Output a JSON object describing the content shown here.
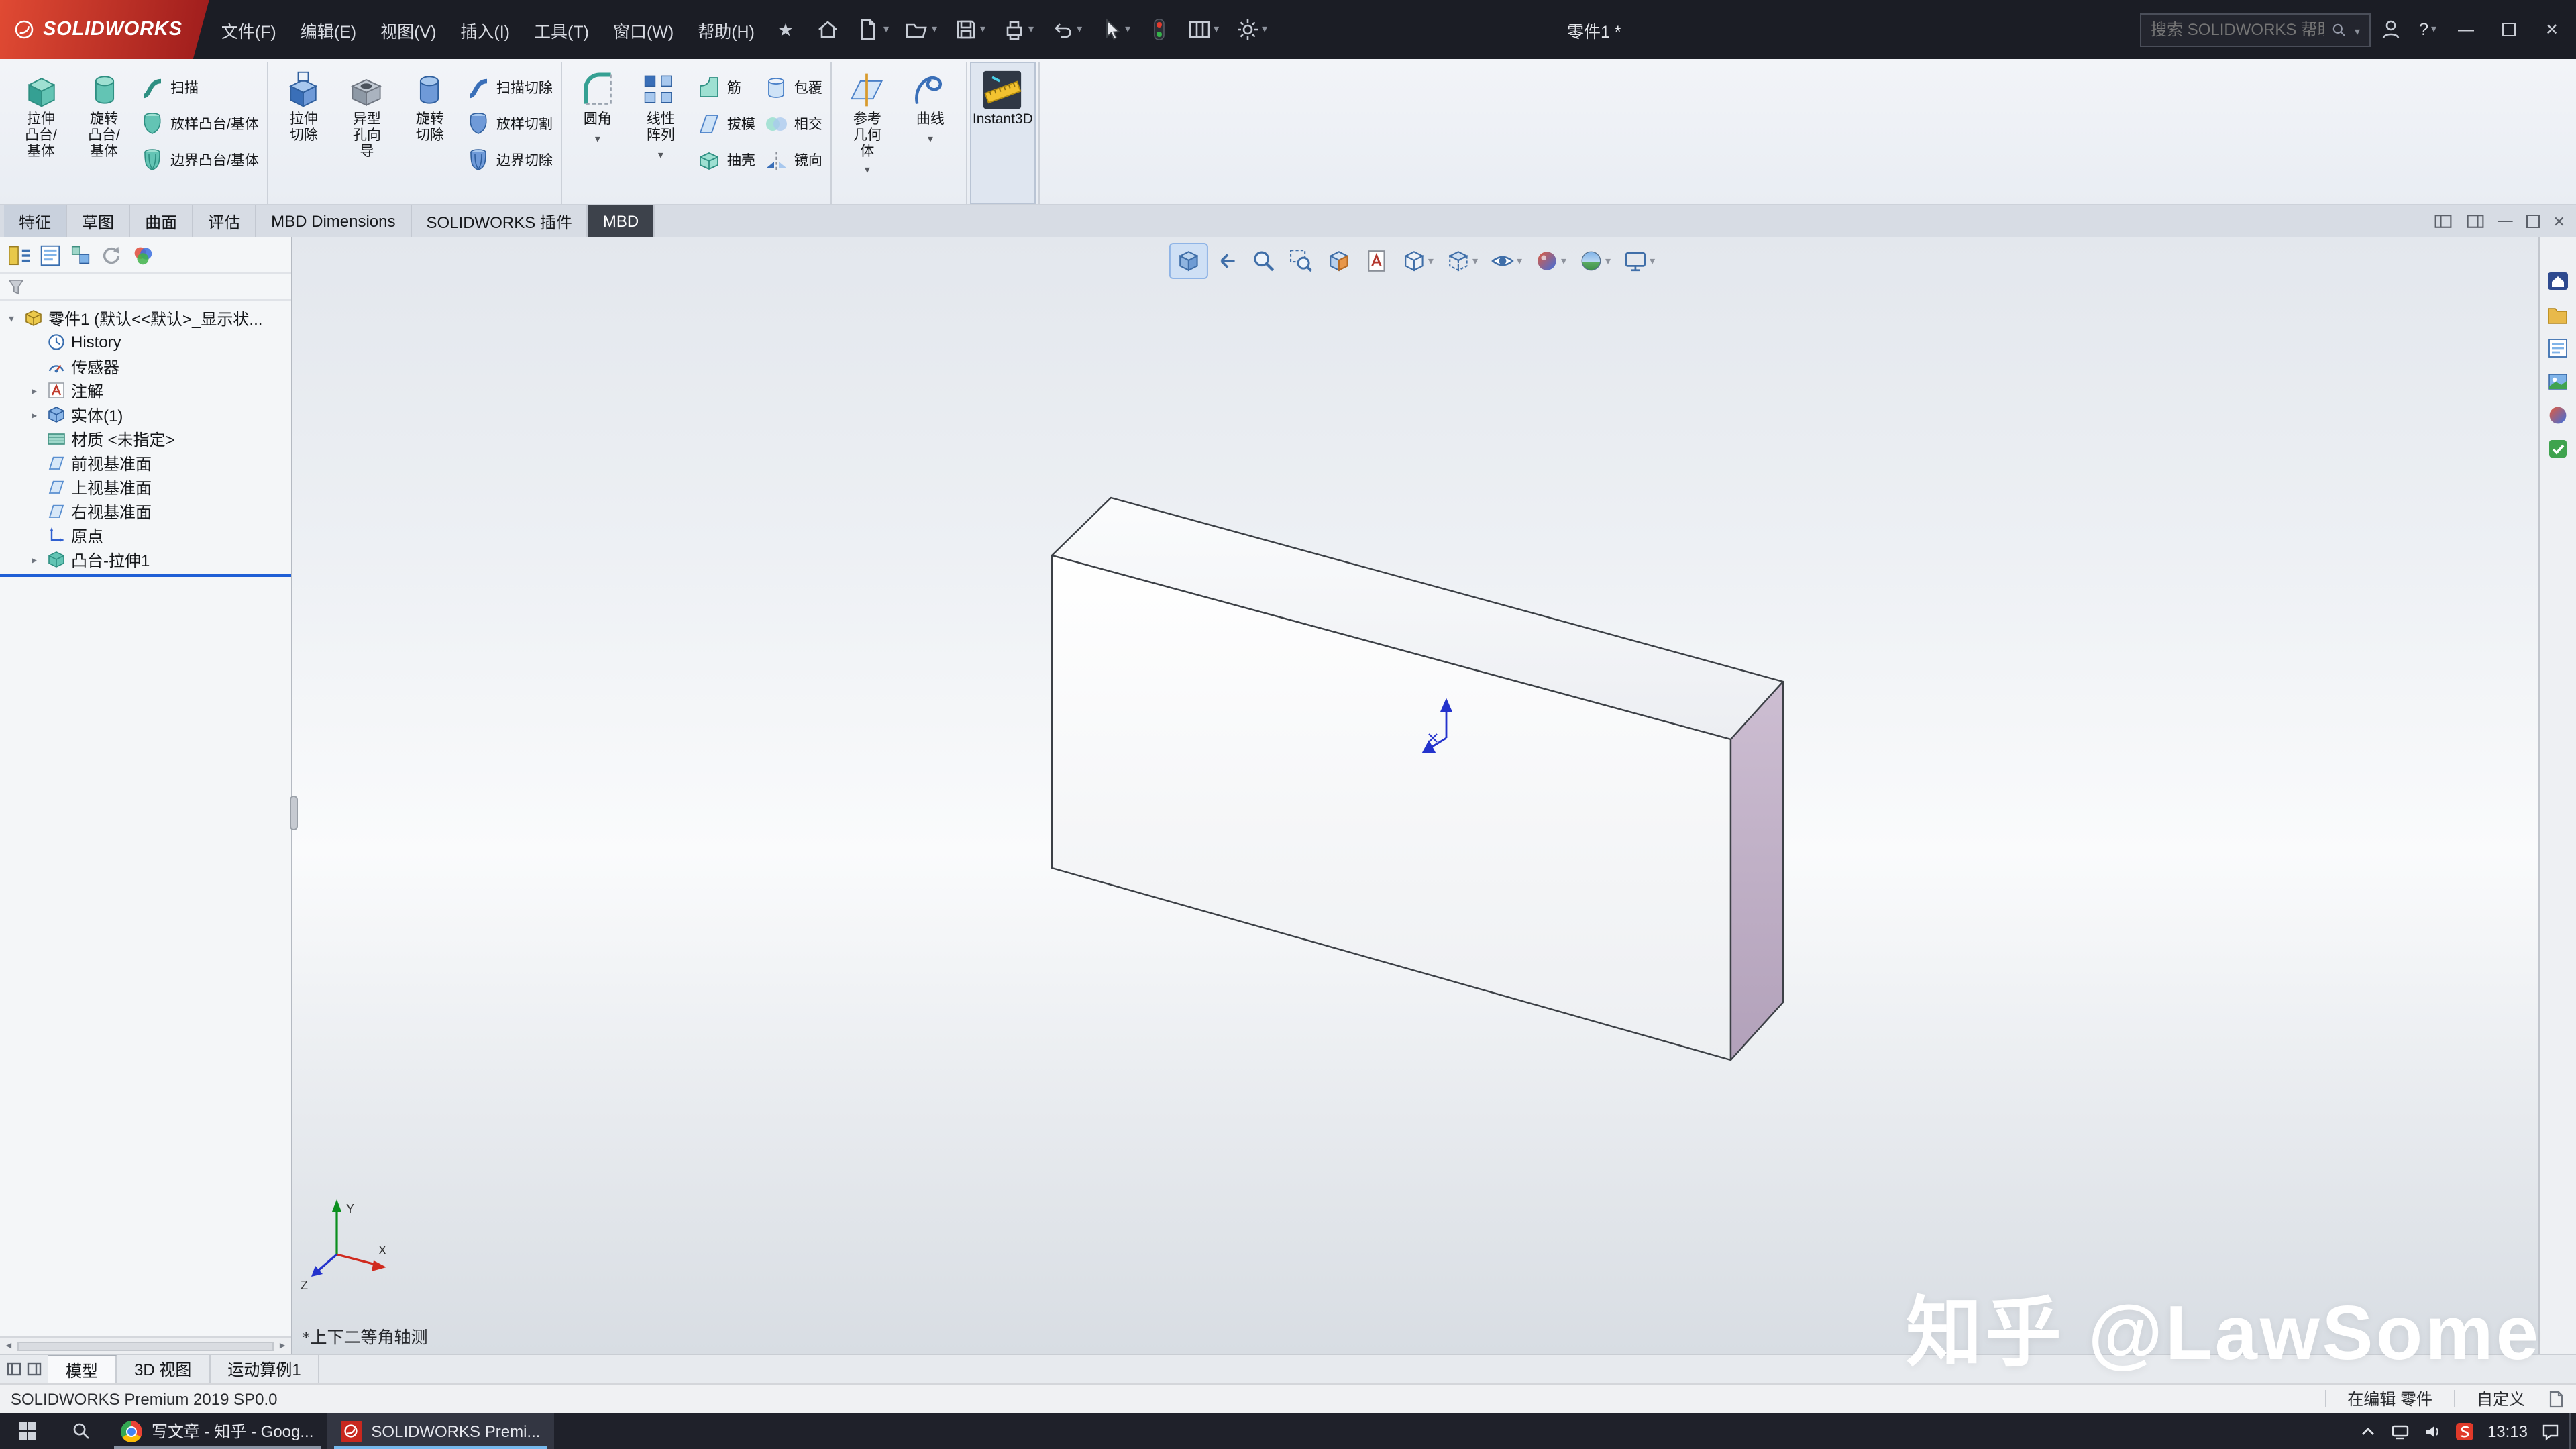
{
  "titlebar": {
    "logo_text": "SOLIDWORKS",
    "menus": [
      "文件(F)",
      "编辑(E)",
      "视图(V)",
      "插入(I)",
      "工具(T)",
      "窗口(W)",
      "帮助(H)"
    ],
    "document_title": "零件1 *",
    "search_placeholder": "搜索 SOLIDWORKS 帮助",
    "help_label": "?"
  },
  "ribbon": {
    "extrude_boss": "拉伸\n凸台/\n基体",
    "revolve_boss": "旋转\n凸台/\n基体",
    "sweep": "扫描",
    "loft": "放样凸台/基体",
    "boundary": "边界凸台/基体",
    "extrude_cut": "拉伸\n切除",
    "hole_wizard": "异型\n孔向\n导",
    "revolve_cut": "旋转\n切除",
    "sweep_cut": "扫描切除",
    "loft_cut": "放样切割",
    "boundary_cut": "边界切除",
    "fillet": "圆角",
    "linear_pattern": "线性\n阵列",
    "rib": "筋",
    "draft": "拔模",
    "shell": "抽壳",
    "wrap": "包覆",
    "intersect": "相交",
    "mirror": "镜向",
    "ref_geometry": "参考\n几何\n体",
    "curves": "曲线",
    "instant3d": "Instant3D"
  },
  "command_tabs": [
    "特征",
    "草图",
    "曲面",
    "评估",
    "MBD Dimensions",
    "SOLIDWORKS 插件",
    "MBD"
  ],
  "feature_tree": {
    "root": "零件1 (默认<<默认>_显示状...",
    "items": [
      "History",
      "传感器",
      "注解",
      "实体(1)",
      "材质 <未指定>",
      "前视基准面",
      "上视基准面",
      "右视基准面",
      "原点",
      "凸台-拉伸1"
    ]
  },
  "viewport": {
    "view_label": "*上下二等角轴测",
    "watermark": "知乎 @LawSome",
    "side_face_color": "#c9b8cd",
    "selection_blue": "#1f5fd6"
  },
  "doc_tabs": [
    "模型",
    "3D 视图",
    "运动算例1"
  ],
  "statusbar": {
    "product": "SOLIDWORKS Premium 2019 SP0.0",
    "editing_status": "在编辑 零件",
    "customize": "自定义"
  },
  "taskbar": {
    "apps": [
      "写文章 - 知乎 - Goog...",
      "SOLIDWORKS Premi..."
    ],
    "time": "13:13"
  }
}
